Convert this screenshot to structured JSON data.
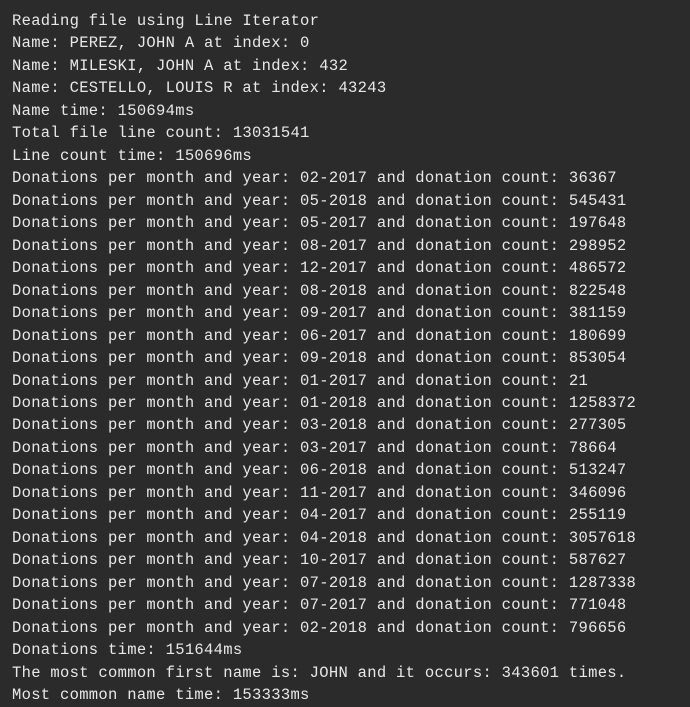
{
  "header": "Reading file using Line Iterator",
  "names": [
    {
      "name": "PEREZ, JOHN A",
      "index": 0
    },
    {
      "name": "MILESKI, JOHN A",
      "index": 432
    },
    {
      "name": "CESTELLO, LOUIS R",
      "index": 43243
    }
  ],
  "name_time_ms": 150694,
  "total_line_count": 13031541,
  "line_count_time_ms": 150696,
  "donations": [
    {
      "month_year": "02-2017",
      "count": 36367
    },
    {
      "month_year": "05-2018",
      "count": 545431
    },
    {
      "month_year": "05-2017",
      "count": 197648
    },
    {
      "month_year": "08-2017",
      "count": 298952
    },
    {
      "month_year": "12-2017",
      "count": 486572
    },
    {
      "month_year": "08-2018",
      "count": 822548
    },
    {
      "month_year": "09-2017",
      "count": 381159
    },
    {
      "month_year": "06-2017",
      "count": 180699
    },
    {
      "month_year": "09-2018",
      "count": 853054
    },
    {
      "month_year": "01-2017",
      "count": 21
    },
    {
      "month_year": "01-2018",
      "count": 1258372
    },
    {
      "month_year": "03-2018",
      "count": 277305
    },
    {
      "month_year": "03-2017",
      "count": 78664
    },
    {
      "month_year": "06-2018",
      "count": 513247
    },
    {
      "month_year": "11-2017",
      "count": 346096
    },
    {
      "month_year": "04-2017",
      "count": 255119
    },
    {
      "month_year": "04-2018",
      "count": 3057618
    },
    {
      "month_year": "10-2017",
      "count": 587627
    },
    {
      "month_year": "07-2018",
      "count": 1287338
    },
    {
      "month_year": "07-2017",
      "count": 771048
    },
    {
      "month_year": "02-2018",
      "count": 796656
    }
  ],
  "donations_time_ms": 151644,
  "most_common_first_name": "JOHN",
  "most_common_first_name_count": 343601,
  "most_common_name_time_ms": 153333,
  "labels": {
    "name_prefix": "Name: ",
    "at_index": " at index: ",
    "name_time_prefix": "Name time: ",
    "ms_suffix": "ms",
    "total_line_count_prefix": "Total file line count: ",
    "line_count_time_prefix": "Line count time: ",
    "donations_prefix": "Donations per month and year: ",
    "donations_mid": " and donation count: ",
    "donations_time_prefix": "Donations time: ",
    "most_common_prefix": "The most common first name is: ",
    "and_occurs": " and it occurs: ",
    "times_suffix": " times.",
    "most_common_time_prefix": "Most common name time: "
  }
}
